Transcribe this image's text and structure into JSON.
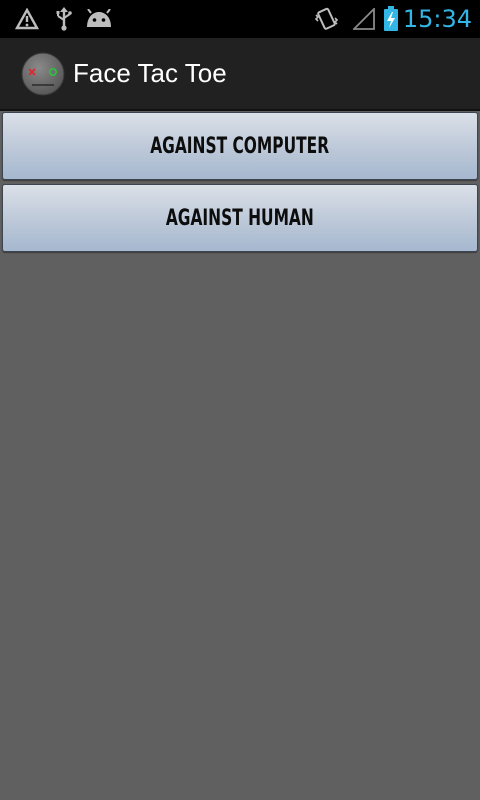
{
  "status_bar": {
    "time": "15:34",
    "left_icons": [
      "warning-triangle-icon",
      "usb-icon",
      "android-debug-icon"
    ],
    "right_icons": [
      "vibrate-icon",
      "signal-icon",
      "battery-charging-icon"
    ],
    "time_color": "#33b5e5"
  },
  "action_bar": {
    "title": "Face Tac Toe",
    "icon": "face-tac-toe-app-icon"
  },
  "buttons": [
    {
      "label": "AGAINST COMPUTER"
    },
    {
      "label": "AGAINST HUMAN"
    }
  ],
  "colors": {
    "background": "#606060",
    "action_bar": "#212121",
    "button_top": "#dbe0e8",
    "button_bottom": "#a6b8cf"
  }
}
